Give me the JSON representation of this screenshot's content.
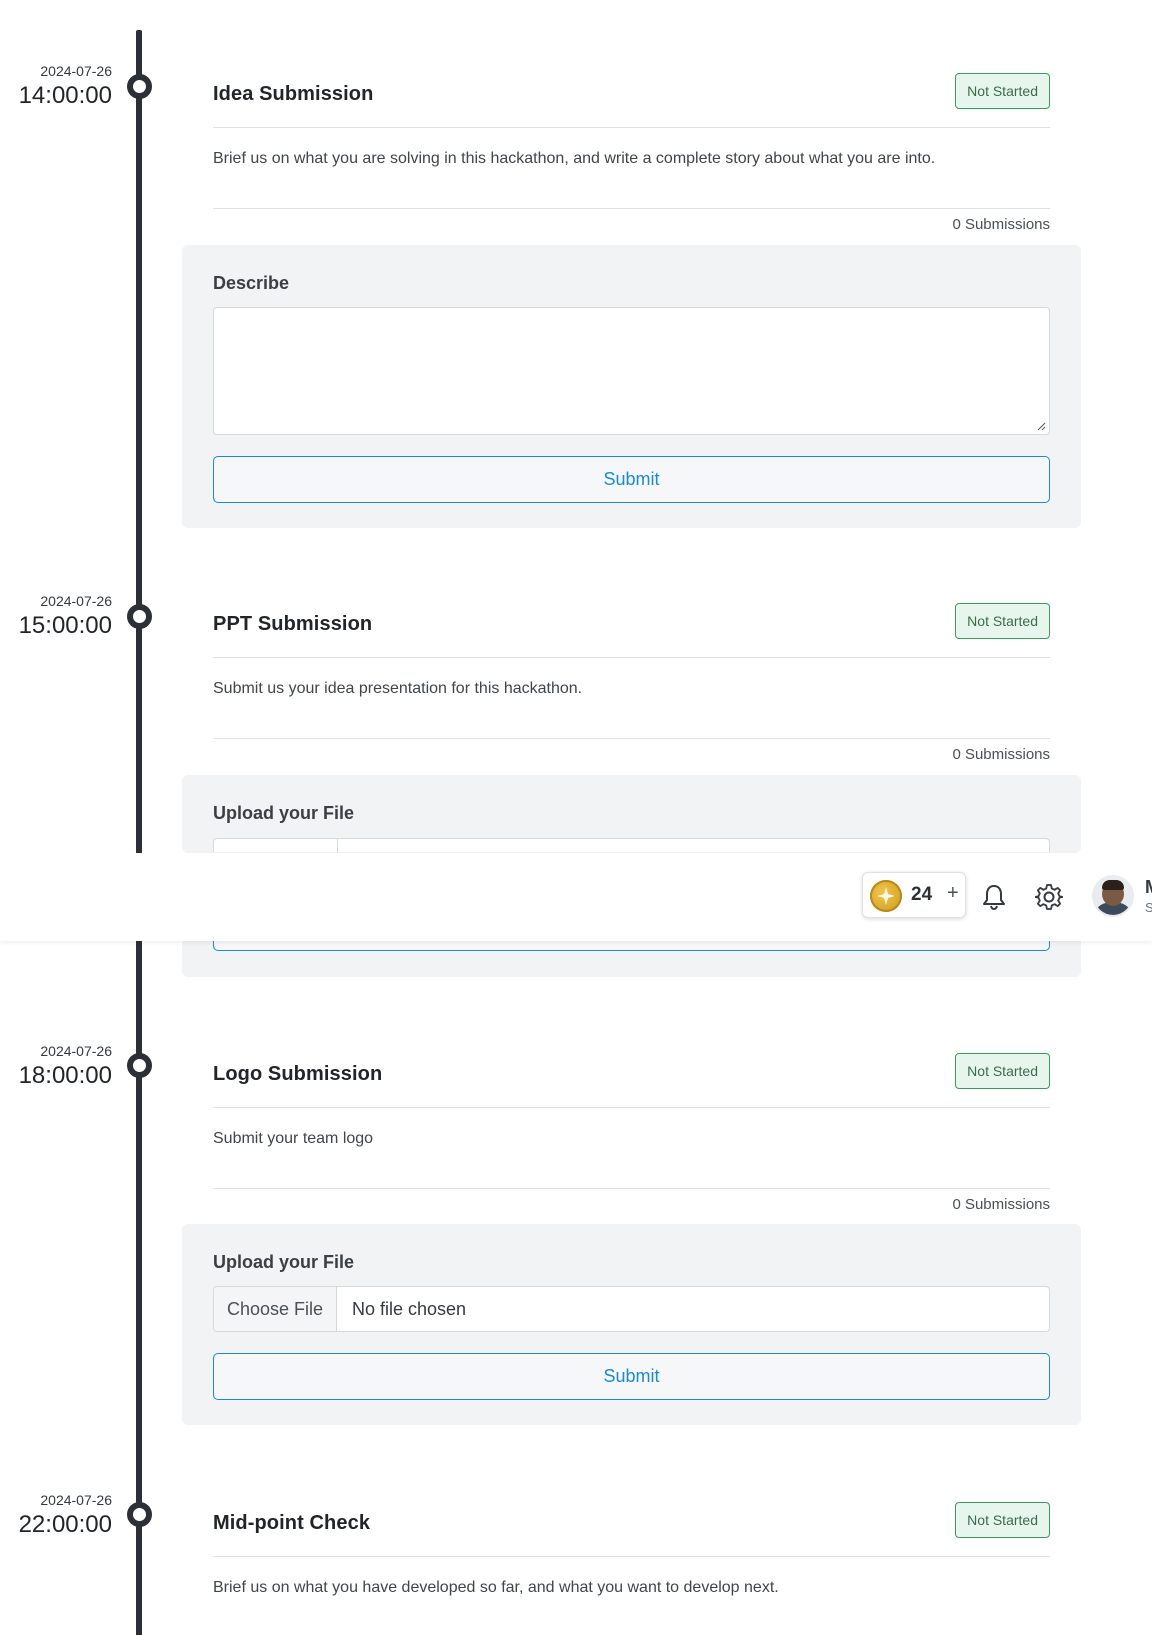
{
  "milestones": [
    {
      "date": "2024-07-26",
      "time": "14:00:00",
      "title": "Idea Submission",
      "status": "Not Started",
      "description": "Brief us on what you are solving in this hackathon, and write a complete story about what you are into.",
      "submissions": "0 Submissions",
      "form_label": "Describe",
      "submit_label": "Submit"
    },
    {
      "date": "2024-07-26",
      "time": "15:00:00",
      "title": "PPT Submission",
      "status": "Not Started",
      "description": "Submit us your idea presentation for this hackathon.",
      "submissions": "0 Submissions",
      "form_label": "Upload your File"
    },
    {
      "date": "2024-07-26",
      "time": "18:00:00",
      "title": "Logo Submission",
      "status": "Not Started",
      "description": "Submit your team logo",
      "submissions": "0 Submissions",
      "form_label": "Upload your File",
      "file_button": "Choose File",
      "file_status": "No file chosen",
      "submit_label": "Submit"
    },
    {
      "date": "2024-07-26",
      "time": "22:00:00",
      "title": "Mid-point Check",
      "status": "Not Started",
      "description": "Brief us on what you have developed so far, and what you want to develop next."
    }
  ],
  "topbar": {
    "credits": "24",
    "add_credits_label": "+",
    "user_initial": "M",
    "user_sub": "S",
    "icons": [
      "coin-icon",
      "bell-icon",
      "gear-icon"
    ]
  },
  "colors": {
    "timeline": "#2b3036",
    "status_badge_bg": "#e7f6ec",
    "status_badge_border": "#3d9a5a",
    "primary": "#1b8ad0",
    "panel_bg": "#f2f3f4"
  }
}
